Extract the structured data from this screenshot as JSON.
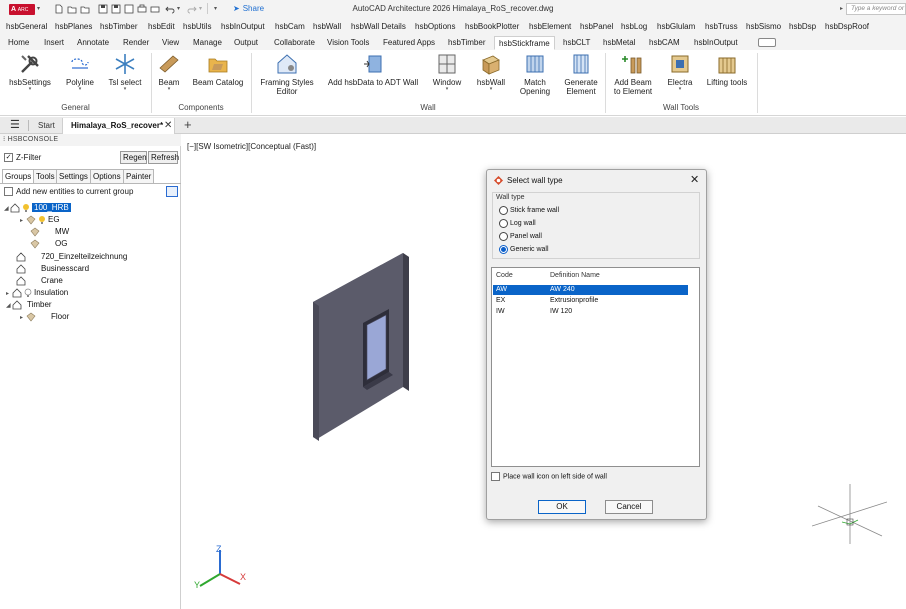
{
  "titlebar": {
    "app_button": "A",
    "app_button_sub": "ARC",
    "share_label": "Share",
    "window_title": "AutoCAD Architecture 2026   Himalaya_RoS_recover.dwg",
    "search_placeholder": "Type a keyword or phrase"
  },
  "menu": {
    "items": [
      "hsbGeneral",
      "hsbPlanes",
      "hsbTimber",
      "hsbEdit",
      "hsbUtils",
      "hsbInOutput",
      "hsbCam",
      "hsbWall",
      "hsbWall Details",
      "hsbOptions",
      "hsbBookPlotter",
      "hsbElement",
      "hsbPanel",
      "hsbLog",
      "hsbGlulam",
      "hsbTruss",
      "hsbSismo",
      "hsbDsp",
      "hsbDspRoof"
    ]
  },
  "ribbon_tabs": {
    "items": [
      "Home",
      "Insert",
      "Annotate",
      "Render",
      "View",
      "Manage",
      "Output",
      "Collaborate",
      "Vision Tools",
      "Featured Apps",
      "hsbTimber",
      "hsbStickframe",
      "hsbCLT",
      "hsbMetal",
      "hsbCAM",
      "hsbInOutput"
    ],
    "active": "hsbStickframe"
  },
  "ribbon": {
    "buttons": {
      "hsbsettings": {
        "l1": "hsbSettings",
        "l2": ""
      },
      "polyline": {
        "l1": "Polyline",
        "l2": ""
      },
      "tsl_select": {
        "l1": "Tsl select",
        "l2": ""
      },
      "beam": {
        "l1": "Beam",
        "l2": ""
      },
      "beam_catalog": {
        "l1": "Beam Catalog",
        "l2": ""
      },
      "framing_styles": {
        "l1": "Framing Styles",
        "l2": "Editor"
      },
      "add_hsbdata": {
        "l1": "Add hsbData to ADT Wall",
        "l2": ""
      },
      "window": {
        "l1": "Window",
        "l2": ""
      },
      "hsbwall": {
        "l1": "hsbWall",
        "l2": ""
      },
      "match_opening": {
        "l1": "Match",
        "l2": "Opening"
      },
      "generate_element": {
        "l1": "Generate",
        "l2": "Element"
      },
      "add_beam_element": {
        "l1": "Add Beam",
        "l2": "to Element"
      },
      "electra": {
        "l1": "Electra",
        "l2": ""
      },
      "lifting_tools": {
        "l1": "Lifting tools",
        "l2": ""
      }
    },
    "panels": {
      "general": "General",
      "components": "Components",
      "wall": "Wall",
      "wall_tools": "Wall Tools"
    }
  },
  "doc_tabs": {
    "start": "Start",
    "file": "Himalaya_RoS_recover*"
  },
  "console": {
    "header": "HSBCONSOLE",
    "zfilter": "Z-Filter",
    "regen": "Regen",
    "refresh": "Refresh",
    "tabs": [
      "Groups",
      "Tools",
      "Settings",
      "Options",
      "Painter"
    ],
    "add_new": "Add new entities to current group",
    "tree": [
      {
        "label": "100_HRB"
      },
      {
        "label": "EG"
      },
      {
        "label": "MW"
      },
      {
        "label": "OG"
      },
      {
        "label": "720_Einzelteilzeichnung"
      },
      {
        "label": "Businesscard"
      },
      {
        "label": "Crane"
      },
      {
        "label": "Insulation"
      },
      {
        "label": "Timber"
      },
      {
        "label": "Floor"
      }
    ]
  },
  "viewport": {
    "label": "[−][SW Isometric][Conceptual (Fast)]"
  },
  "dialog": {
    "title": "Select wall type",
    "group_caption": "Wall type",
    "radios": [
      {
        "label": "Stick frame wall",
        "checked": false
      },
      {
        "label": "Log wall",
        "checked": false
      },
      {
        "label": "Panel wall",
        "checked": false
      },
      {
        "label": "Generic wall",
        "checked": true
      }
    ],
    "columns": {
      "code": "Code",
      "name": "Definition Name"
    },
    "rows": [
      {
        "code": "AW",
        "name": "AW 240"
      },
      {
        "code": "EX",
        "name": "Extrusionprofile"
      },
      {
        "code": "IW",
        "name": "IW 120"
      }
    ],
    "place_icon_label": "Place wall icon on left side of wall",
    "ok": "OK",
    "cancel": "Cancel"
  },
  "colors": {
    "accent": "#0a64c8",
    "app_red": "#c8102e",
    "wall_face": "#5b5b6a",
    "glass": "#9aa7d6"
  }
}
